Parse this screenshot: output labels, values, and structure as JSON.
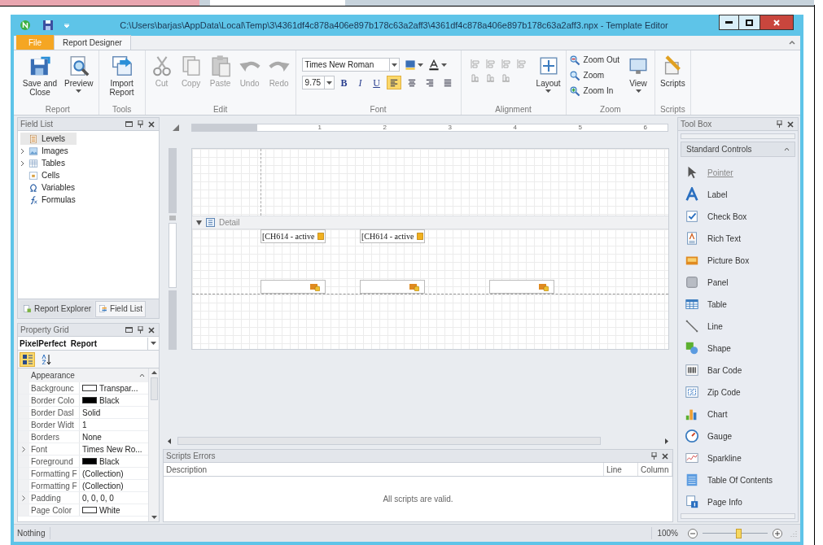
{
  "window": {
    "title": "C:\\Users\\barjas\\AppData\\Local\\Temp\\3\\4361df4c878a406e897b178c63a2aff3\\4361df4c878a406e897b178c63a2aff3.npx - Template Editor"
  },
  "ribbon_tabs": [
    {
      "label": "File",
      "kind": "file",
      "selected": false
    },
    {
      "label": "Report Designer",
      "kind": "tab",
      "selected": true
    }
  ],
  "ribbon_groups": [
    {
      "label": "Report",
      "items": [
        {
          "kind": "large",
          "label": "Save and Close",
          "dropdown": false,
          "disabled": false
        },
        {
          "kind": "large",
          "label": "Preview",
          "dropdown": true,
          "disabled": false
        }
      ]
    },
    {
      "label": "Tools",
      "items": [
        {
          "kind": "large",
          "label": "Import Report",
          "dropdown": false,
          "disabled": false
        }
      ]
    },
    {
      "label": "Edit",
      "items": [
        {
          "kind": "large",
          "label": "Cut",
          "dropdown": false,
          "disabled": true
        },
        {
          "kind": "large",
          "label": "Copy",
          "dropdown": false,
          "disabled": true
        },
        {
          "kind": "large",
          "label": "Paste",
          "dropdown": false,
          "disabled": true
        },
        {
          "kind": "large",
          "label": "Undo",
          "dropdown": false,
          "disabled": true
        },
        {
          "kind": "large",
          "label": "Redo",
          "dropdown": false,
          "disabled": true
        }
      ]
    },
    {
      "label": "Font",
      "items": [
        {
          "kind": "font",
          "font_name": "Times New Roman",
          "font_size": "9.75",
          "styles": [
            {
              "label": "B"
            },
            {
              "label": "I"
            },
            {
              "label": "U"
            }
          ],
          "alignments": [
            {
              "selected": true
            },
            {
              "selected": false
            },
            {
              "selected": false
            },
            {
              "selected": false
            }
          ]
        }
      ]
    },
    {
      "label": "Alignment",
      "items": [
        {
          "kind": "align_tools"
        },
        {
          "kind": "large",
          "label": "Layout",
          "dropdown": true,
          "disabled": false
        }
      ]
    },
    {
      "label": "Zoom",
      "items": [
        {
          "kind": "small_stack",
          "buttons": [
            {
              "label": "Zoom Out"
            },
            {
              "label": "Zoom"
            },
            {
              "label": "Zoom In"
            }
          ]
        },
        {
          "kind": "large",
          "label": "View",
          "dropdown": true,
          "disabled": false
        }
      ]
    },
    {
      "label": "Scripts",
      "items": [
        {
          "kind": "large",
          "label": "Scripts",
          "dropdown": false,
          "disabled": false
        }
      ]
    }
  ],
  "field_list": {
    "title": "Field List",
    "items": [
      {
        "label": "Levels",
        "expandable": false,
        "selected": true
      },
      {
        "label": "Images",
        "expandable": true,
        "selected": false
      },
      {
        "label": "Tables",
        "expandable": true,
        "selected": false
      },
      {
        "label": "Cells",
        "expandable": false,
        "selected": false
      },
      {
        "label": "Variables",
        "expandable": false,
        "selected": false
      },
      {
        "label": "Formulas",
        "expandable": false,
        "selected": false
      }
    ],
    "tabs": [
      {
        "label": "Report Explorer",
        "selected": false
      },
      {
        "label": "Field List",
        "selected": true
      }
    ]
  },
  "property_grid": {
    "title": "Property Grid",
    "object_name": "PixelPerfect",
    "object_type": "Report",
    "sort_modes": [
      {
        "kind": "categorized",
        "selected": true
      },
      {
        "kind": "alphabetical",
        "selected": false
      }
    ],
    "category": {
      "label": "Appearance",
      "expanded": true
    },
    "rows": [
      {
        "name": "Backgrounc",
        "value": "Transpar...",
        "color": "#ffffff",
        "expandable": false
      },
      {
        "name": "Border Colo",
        "value": "Black",
        "color": "#000000",
        "expandable": false
      },
      {
        "name": "Border Dasl",
        "value": "Solid",
        "expandable": false
      },
      {
        "name": "Border Widt",
        "value": "1",
        "expandable": false
      },
      {
        "name": "Borders",
        "value": "None",
        "expandable": false
      },
      {
        "name": "Font",
        "value": "Times New Ro...",
        "expandable": true
      },
      {
        "name": "Foreground",
        "value": "Black",
        "color": "#000000",
        "expandable": false
      },
      {
        "name": "Formatting F",
        "value": "(Collection)",
        "expandable": false
      },
      {
        "name": "Formatting F",
        "value": "(Collection)",
        "expandable": false
      },
      {
        "name": "Padding",
        "value": "0, 0, 0, 0",
        "expandable": true
      },
      {
        "name": "Page Color",
        "value": "White",
        "color": "#ffffff",
        "expandable": false
      }
    ]
  },
  "designer": {
    "ruler_labels": [
      "1",
      "2",
      "3",
      "4",
      "5",
      "6"
    ],
    "detail_band": {
      "label": "Detail",
      "expanded": true,
      "rows": [
        {
          "fields": [
            {
              "kind": "text",
              "text": "[CH614 - active"
            },
            {
              "kind": "text",
              "text": "[CH614 - active"
            },
            {
              "kind": "empty"
            }
          ]
        },
        {
          "fields": [
            {
              "kind": "picture"
            },
            {
              "kind": "picture"
            },
            {
              "kind": "picture"
            }
          ]
        }
      ]
    }
  },
  "scripts_errors": {
    "title": "Scripts Errors",
    "columns": [
      "Description",
      "Line",
      "Column"
    ],
    "message": "All scripts are valid."
  },
  "toolbox": {
    "title": "Tool Box",
    "section": {
      "label": "Standard Controls",
      "expanded": true
    },
    "items": [
      {
        "label": "Pointer",
        "selected": true
      },
      {
        "label": "Label",
        "selected": false
      },
      {
        "label": "Check Box",
        "selected": false
      },
      {
        "label": "Rich Text",
        "selected": false
      },
      {
        "label": "Picture Box",
        "selected": false
      },
      {
        "label": "Panel",
        "selected": false
      },
      {
        "label": "Table",
        "selected": false
      },
      {
        "label": "Line",
        "selected": false
      },
      {
        "label": "Shape",
        "selected": false
      },
      {
        "label": "Bar Code",
        "selected": false
      },
      {
        "label": "Zip Code",
        "selected": false
      },
      {
        "label": "Chart",
        "selected": false
      },
      {
        "label": "Gauge",
        "selected": false
      },
      {
        "label": "Sparkline",
        "selected": false
      },
      {
        "label": "Table Of Contents",
        "selected": false
      },
      {
        "label": "Page Info",
        "selected": false
      }
    ]
  },
  "status_bar": {
    "text": "Nothing",
    "zoom": "100%",
    "zoom_slider": {
      "level": 0.55
    }
  }
}
